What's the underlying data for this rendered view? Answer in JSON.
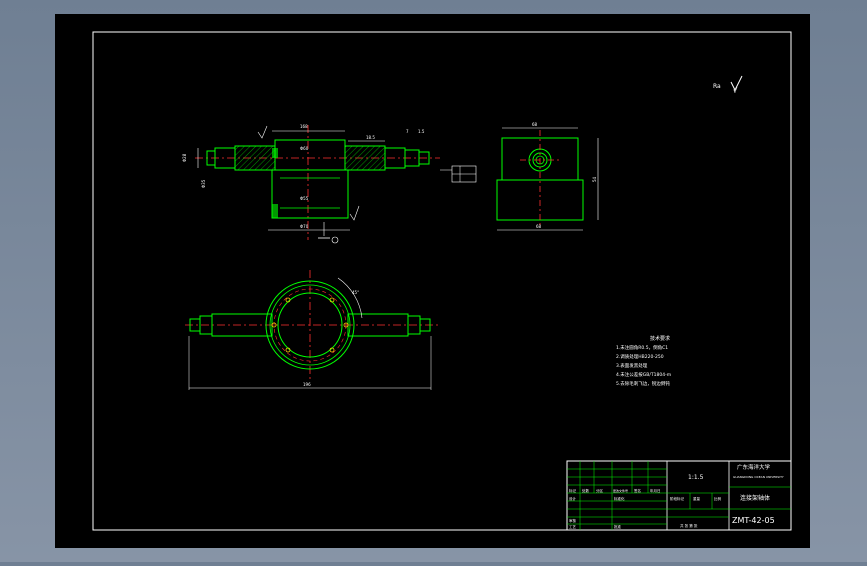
{
  "title_block": {
    "school_cn": "广东海洋大学",
    "school_en": "GUANGDONG OCEAN UNIVERSITY",
    "scale": "1:1.5",
    "part_name": "连接架轴体",
    "drawing_no": "ZMT-42-05",
    "row_labels": [
      "标记",
      "处数",
      "分区",
      "更改文件号",
      "签名",
      "年月日"
    ],
    "row_labels_2": [
      "设计",
      "标准化",
      "阶段标记",
      "重量",
      "比例"
    ],
    "row_labels_3": [
      "审核",
      "工艺",
      "批准",
      "共 张 第 张"
    ]
  },
  "tech_req": {
    "heading": "技术要求",
    "lines": [
      "1.未注圆角R0.5，倒角C1",
      "2.调质处理HB220-250",
      "3.表面发黑处理",
      "4.未注公差按GB/T1804-m",
      "5.去除毛刺飞边，锐边倒钝"
    ]
  },
  "dims": {
    "front_total": "168",
    "front_d1": "Φ28",
    "front_d2": "Φ35",
    "front_len1": "18.5",
    "front_len2": "7",
    "front_len3": "1.5",
    "front_bore": "Φ60",
    "front_bore2": "Φ55",
    "front_bottom": "Φ70",
    "side_width": "68",
    "side_height": "54",
    "side_bottom": "68",
    "plan_total": "196",
    "plan_arc": "45°"
  },
  "surface_mark": "√"
}
